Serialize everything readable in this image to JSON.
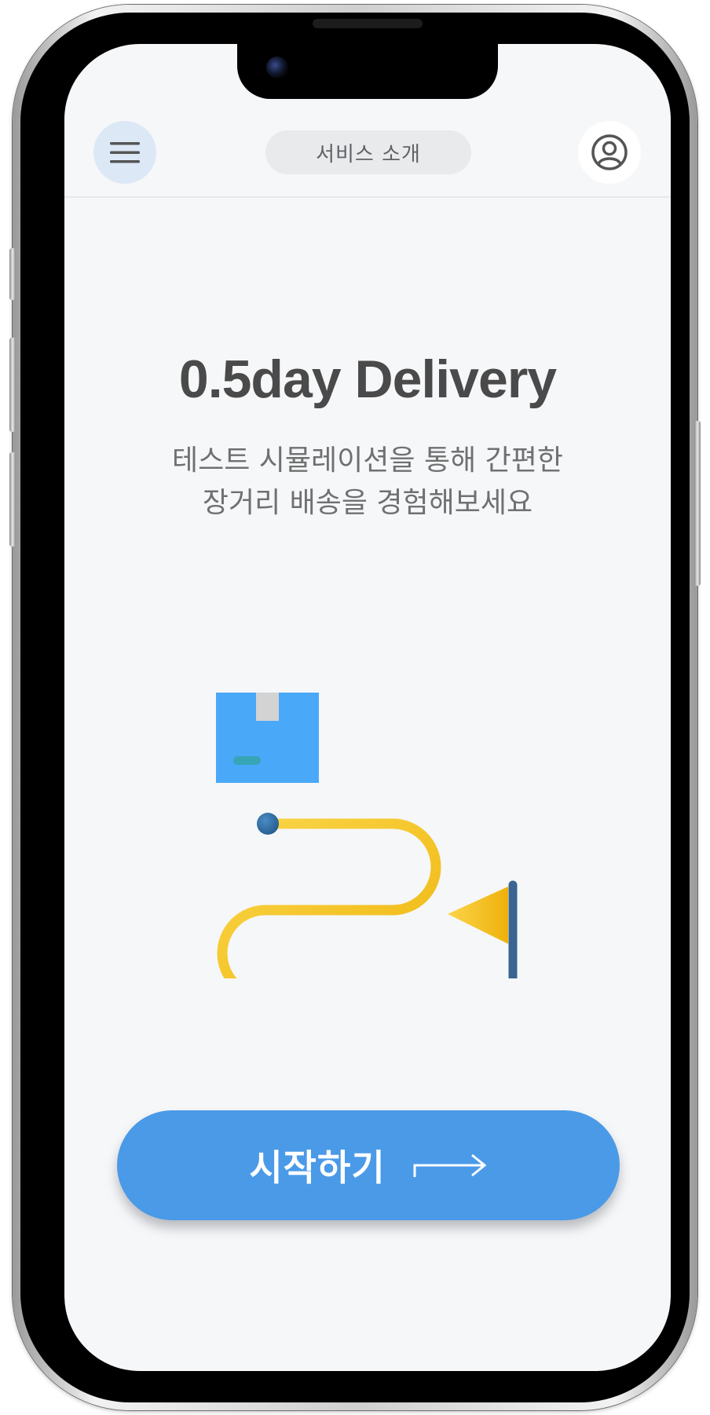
{
  "header": {
    "title": "서비스 소개",
    "menu_icon": "hamburger-menu-icon",
    "profile_icon": "user-profile-icon"
  },
  "hero": {
    "title": "0.5day Delivery",
    "subtitle_line1": "테스트 시뮬레이션을 통해 간편한",
    "subtitle_line2": "장거리 배송을 경험해보세요"
  },
  "illustration": {
    "package_icon": "package-box-icon",
    "route_icon": "delivery-route-icon",
    "flag_icon": "destination-flag-icon"
  },
  "cta": {
    "label": "시작하기",
    "icon": "arrow-right-icon"
  },
  "colors": {
    "accent": "#4a9ae8",
    "background": "#f6f7f9",
    "title_text": "#4a4a4a",
    "route_yellow": "#f5c932",
    "pin_blue": "#2f6fa6",
    "box_blue": "#4aa8f8"
  }
}
